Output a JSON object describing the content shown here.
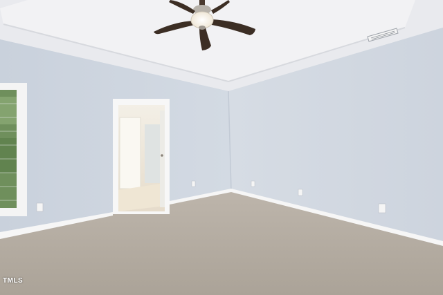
{
  "photo": {
    "watermark": "TMLS",
    "colors": {
      "wall_left": "#cdd5df",
      "wall_right": "#d2d9e2",
      "ceiling": "#ededf0",
      "carpet": "#b6aea4",
      "trim": "#f5f5f5",
      "fan_blade": "#3c2e24"
    }
  }
}
